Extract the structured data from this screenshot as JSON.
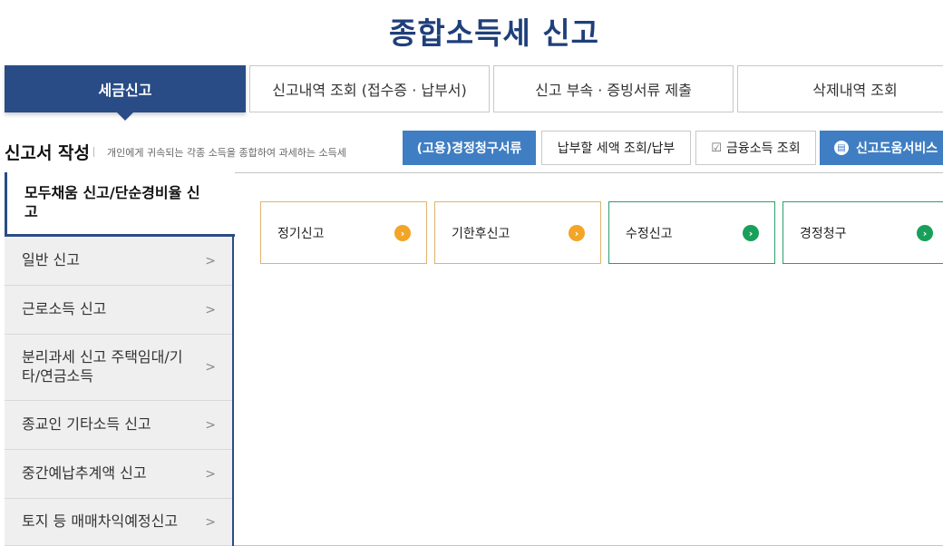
{
  "page_title": "종합소득세 신고",
  "main_tabs": [
    {
      "label": "세금신고",
      "active": true
    },
    {
      "label": "신고내역 조회 (접수증 · 납부서)",
      "active": false
    },
    {
      "label": "신고 부속 · 증빙서류 제출",
      "active": false
    },
    {
      "label": "삭제내역 조회",
      "active": false
    }
  ],
  "subheader": {
    "title": "신고서 작성",
    "description": "개인에게 귀속되는 각종 소득을 종합하여 과세하는 소득세",
    "buttons": [
      {
        "label": "(고용)경정청구서류",
        "style": "blue"
      },
      {
        "label": "납부할 세액 조회/납부",
        "style": "white"
      },
      {
        "label": "금융소득 조회",
        "style": "white",
        "icon": "document-icon"
      },
      {
        "label": "신고도움서비스",
        "style": "blue",
        "icon": "book-icon"
      }
    ]
  },
  "sidebar": {
    "items": [
      {
        "label": "모두채움 신고/단순경비율 신고",
        "active": true
      },
      {
        "label": "일반 신고",
        "chevron": ">"
      },
      {
        "label": "근로소득 신고",
        "chevron": ">"
      },
      {
        "label": "분리과세 신고 주택임대/기타/연금소득",
        "chevron": ">"
      },
      {
        "label": "종교인 기타소득 신고",
        "chevron": ">"
      },
      {
        "label": "중간예납추계액 신고",
        "chevron": ">"
      },
      {
        "label": "토지 등 매매차익예정신고",
        "chevron": ">"
      }
    ]
  },
  "cards": [
    {
      "label": "정기신고",
      "color": "#f3a527",
      "arrow": "›"
    },
    {
      "label": "기한후신고",
      "color": "#f3a527",
      "arrow": "›"
    },
    {
      "label": "수정신고",
      "color": "#18a05a",
      "arrow": "›"
    },
    {
      "label": "경정청구",
      "color": "#18a05a",
      "arrow": "›"
    }
  ],
  "colors": {
    "primary": "#294c86",
    "accent_blue": "#3f7ec3",
    "orange": "#f3a527",
    "green": "#18a05a"
  }
}
